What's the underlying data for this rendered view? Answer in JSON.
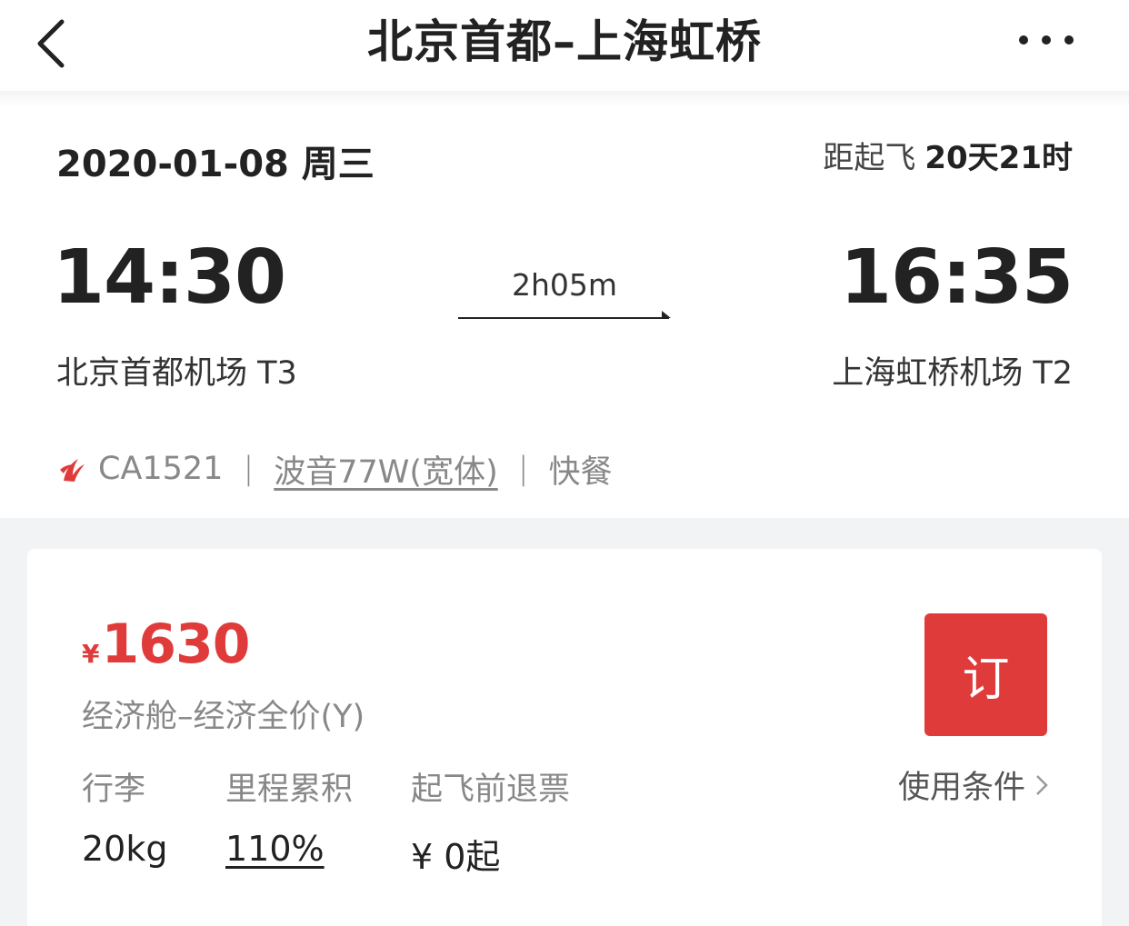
{
  "nav": {
    "title": "北京首都–上海虹桥",
    "back_icon": "chevron-left-icon",
    "more_icon": "more-horizontal-icon"
  },
  "flight": {
    "date": "2020-01-08 周三",
    "countdown_label": "距起飞",
    "countdown_value": "20天21时",
    "departure_time": "14:30",
    "arrival_time": "16:35",
    "duration": "2h05m",
    "departure_airport": "北京首都机场 T3",
    "arrival_airport": "上海虹桥机场 T2",
    "airline_icon": "air-china-logo-icon",
    "flight_no": "CA1521",
    "separator": "|",
    "aircraft": "波音77W(宽体)",
    "meal": "快餐"
  },
  "fare": {
    "currency": "¥",
    "price": "1630",
    "cabin": "经济舱–经济全价(Y)",
    "book_label": "订",
    "terms_label": "使用条件",
    "baggage_label": "行李",
    "baggage_value": "20kg",
    "miles_label": "里程累积",
    "miles_value": "110%",
    "refund_label": "起飞前退票",
    "refund_value": "¥ 0起"
  },
  "colors": {
    "accent": "#e03b3b",
    "background_grey": "#f2f3f5"
  }
}
